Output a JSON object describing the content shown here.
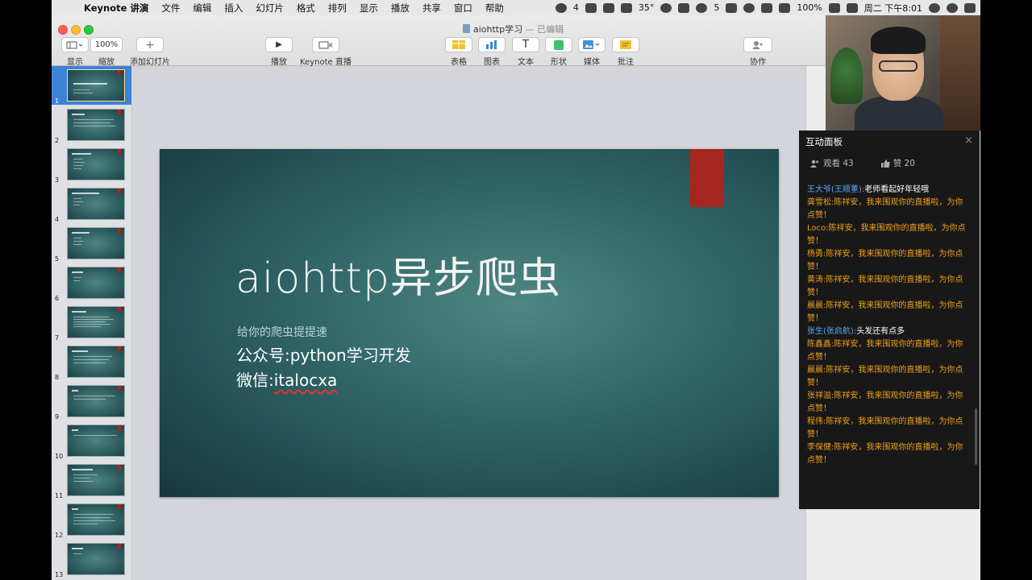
{
  "menubar": {
    "app": "Keynote 讲演",
    "items": [
      "文件",
      "编辑",
      "插入",
      "幻灯片",
      "格式",
      "排列",
      "显示",
      "播放",
      "共享",
      "窗口",
      "帮助"
    ],
    "status": {
      "wechat_count": "4",
      "temp": "35°",
      "count5": "5",
      "battery": "100%",
      "clock": "周二 下午8:01"
    }
  },
  "window": {
    "title": "aiohttp学习",
    "edited": "— 已编辑"
  },
  "toolbar": {
    "view_label": "显示",
    "zoom_value": "100%",
    "zoom_label": "缩放",
    "add_slide_label": "添加幻灯片",
    "play_label": "播放",
    "live_label": "Keynote 直播",
    "table_label": "表格",
    "chart_label": "图表",
    "text_label": "文本",
    "text_glyph": "T",
    "shape_label": "形状",
    "media_label": "媒体",
    "comment_label": "批注",
    "collab_label": "协作"
  },
  "slides": {
    "numbers": [
      "1",
      "2",
      "3",
      "4",
      "5",
      "6",
      "7",
      "8",
      "9",
      "10",
      "11",
      "12",
      "13"
    ],
    "current": "1"
  },
  "slide": {
    "title": "aiohttp异步爬虫",
    "subtitle": "给你的爬虫提提速",
    "line2": "公众号:python学习开发",
    "line3_prefix": "微信:",
    "line3_id": "italocxa"
  },
  "panel": {
    "title": "互动面板",
    "close": "×",
    "viewers": "观看 43",
    "likes": "赞 20",
    "messages": [
      {
        "nick": "王大爷(王顺董)",
        "sep": ":",
        "text": "老师看起好年轻哦",
        "style": "special"
      },
      {
        "nick": "龚雪松",
        "sep": ":",
        "text": "陈祥安，我来围观你的直播啦，为你点赞！",
        "style": "system"
      },
      {
        "nick": "Loco",
        "sep": ":",
        "text": "陈祥安，我来围观你的直播啦，为你点赞！",
        "style": "system"
      },
      {
        "nick": "杨勇",
        "sep": ":",
        "text": "陈祥安，我来围观你的直播啦，为你点赞！",
        "style": "system"
      },
      {
        "nick": "黄涛",
        "sep": ":",
        "text": "陈祥安，我来围观你的直播啦，为你点赞！",
        "style": "system"
      },
      {
        "nick": "晨晨",
        "sep": ":",
        "text": "陈祥安，我来围观你的直播啦，为你点赞！",
        "style": "system"
      },
      {
        "nick": "张生(张启航)",
        "sep": ":",
        "text": "头发还有点多",
        "style": "special"
      },
      {
        "nick": "陈鑫鑫",
        "sep": ":",
        "text": "陈祥安，我来围观你的直播啦，为你点赞！",
        "style": "system"
      },
      {
        "nick": "晨晨",
        "sep": ":",
        "text": "陈祥安，我来围观你的直播啦，为你点赞！",
        "style": "system"
      },
      {
        "nick": "张祥溢",
        "sep": ":",
        "text": "陈祥安，我来围观你的直播啦，为你点赞！",
        "style": "system"
      },
      {
        "nick": "程伟",
        "sep": ":",
        "text": "陈祥安，我来围观你的直播啦，为你点赞！",
        "style": "system"
      },
      {
        "nick": "李保健",
        "sep": ":",
        "text": "陈祥安，我来围观你的直播啦，为你点赞！",
        "style": "system"
      }
    ]
  },
  "colors": {
    "accent_red": "#a4261f",
    "slide_bg": "#356b6c",
    "selection_blue": "#3b82d9",
    "chat_orange": "#f0a01a",
    "chat_blue": "#5aa6f0"
  },
  "icons": {
    "apple": "",
    "play": "▶",
    "plus": "+"
  }
}
